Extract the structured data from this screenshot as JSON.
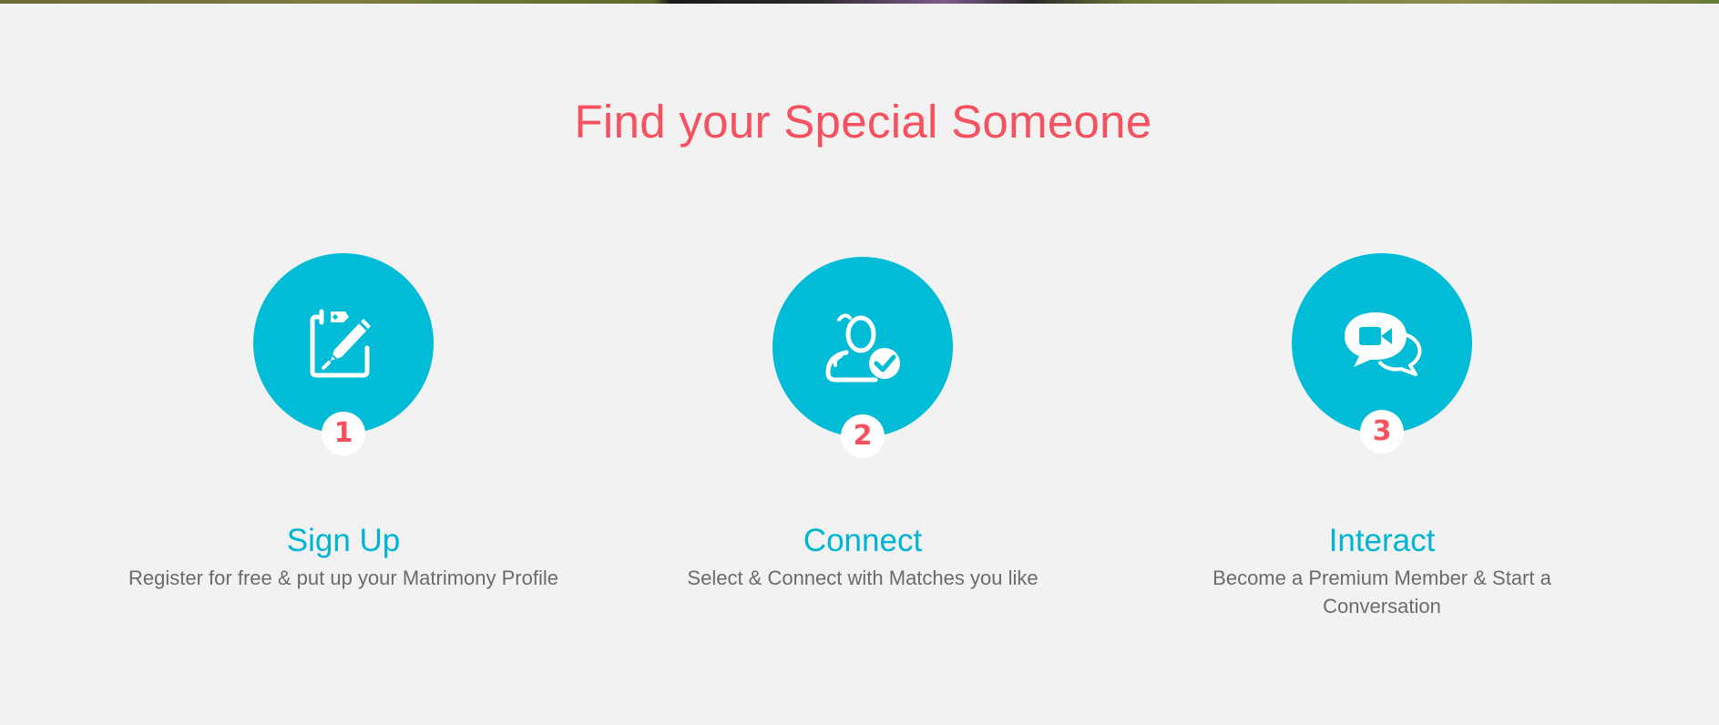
{
  "section": {
    "title": "Find your Special Someone"
  },
  "colors": {
    "accent": "#f5515f",
    "circle": "#00bcd6",
    "step_title": "#00b5d3",
    "text": "#6b6b6b",
    "background": "#f2f2f2"
  },
  "steps": [
    {
      "number": "1",
      "icon": "edit-profile-icon",
      "title": "Sign Up",
      "description": "Register for free & put up your Matrimony Profile"
    },
    {
      "number": "2",
      "icon": "user-check-icon",
      "title": "Connect",
      "description": "Select & Connect with Matches you like"
    },
    {
      "number": "3",
      "icon": "video-chat-icon",
      "title": "Interact",
      "description": "Become a Premium Member & Start a Conversation"
    }
  ]
}
